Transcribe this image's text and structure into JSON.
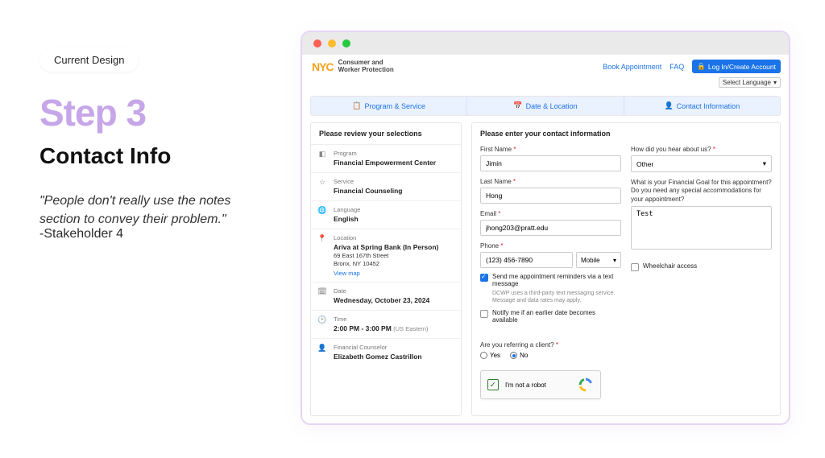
{
  "presentation": {
    "badge": "Current Design",
    "step": "Step 3",
    "subtitle": "Contact Info",
    "quote": "\"People don't really use the notes section to convey their problem.\"",
    "attribution": "-Stakeholder 4"
  },
  "header": {
    "logo_tag": "Consumer and\nWorker Protection",
    "links": {
      "book": "Book Appointment",
      "faq": "FAQ",
      "login": "Log In/Create Account"
    },
    "language_selector": "Select Language"
  },
  "stepper": {
    "s1": "Program & Service",
    "s2": "Date & Location",
    "s3": "Contact Information"
  },
  "review": {
    "title": "Please review your selections",
    "items": {
      "program": {
        "label": "Program",
        "value": "Financial Empowerment Center"
      },
      "service": {
        "label": "Service",
        "value": "Financial Counseling"
      },
      "language": {
        "label": "Language",
        "value": "English"
      },
      "location": {
        "label": "Location",
        "value": "Ariva at Spring Bank (In Person)",
        "line2": "69 East 167th Street",
        "line3": "Bronx, NY 10452",
        "maplink": "View map"
      },
      "date": {
        "label": "Date",
        "value": "Wednesday, October 23, 2024"
      },
      "time": {
        "label": "Time",
        "value": "2:00 PM - 3:00 PM",
        "tz": "(US Eastern)"
      },
      "counselor": {
        "label": "Financial Counselor",
        "value": "Elizabeth Gomez Castrillon"
      }
    }
  },
  "form": {
    "title": "Please enter your contact information",
    "first_name": {
      "label": "First Name",
      "value": "Jimin"
    },
    "last_name": {
      "label": "Last Name",
      "value": "Hong"
    },
    "email": {
      "label": "Email",
      "value": "jhong203@pratt.edu"
    },
    "phone": {
      "label": "Phone",
      "value": "(123) 456-7890",
      "type": "Mobile"
    },
    "sms": {
      "label": "Send me appointment reminders via a text message",
      "fineprint": "DCWP uses a third-party text messaging service. Message and data rates may apply."
    },
    "earlier": {
      "label": "Notify me if an earlier date becomes available"
    },
    "hear": {
      "label": "How did you hear about us?",
      "value": "Other"
    },
    "goal": {
      "label": "What is your Financial Goal for this appointment? Do you need any special accommodations for your appointment?",
      "value": "Test"
    },
    "wheelchair": {
      "label": "Wheelchair access"
    },
    "referring": {
      "label": "Are you referring a client?",
      "yes": "Yes",
      "no": "No"
    },
    "recaptcha": "I'm not a robot"
  }
}
